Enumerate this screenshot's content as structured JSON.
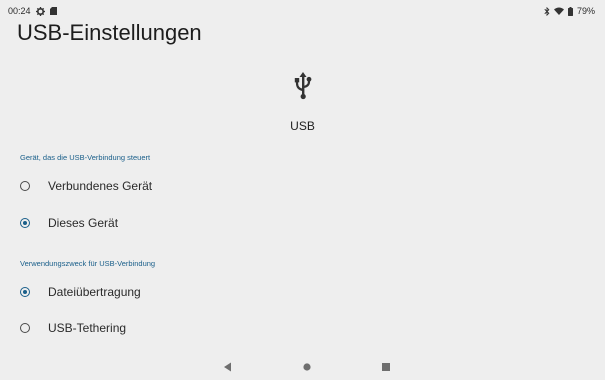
{
  "status_bar": {
    "time": "00:24",
    "battery": "79%",
    "icons_left": [
      "gear-icon",
      "sim-card-icon"
    ],
    "icons_right": [
      "bluetooth-icon",
      "wifi-icon",
      "battery-icon"
    ]
  },
  "page": {
    "title": "USB-Einstellungen",
    "usb_label": "USB"
  },
  "section_controller": {
    "label": "Gerät, das die USB-Verbindung steuert",
    "options": [
      {
        "label": "Verbundenes Gerät",
        "selected": false
      },
      {
        "label": "Dieses Gerät",
        "selected": true
      }
    ]
  },
  "section_purpose": {
    "label": "Verwendungszweck für USB-Verbindung",
    "options": [
      {
        "label": "Dateiübertragung",
        "selected": true
      },
      {
        "label": "USB-Tethering",
        "selected": false
      }
    ]
  },
  "nav_bar": {
    "buttons": [
      "back-icon",
      "home-icon",
      "recents-icon"
    ]
  },
  "colors": {
    "accent": "#1a5f8a",
    "background": "#eeeeee"
  }
}
